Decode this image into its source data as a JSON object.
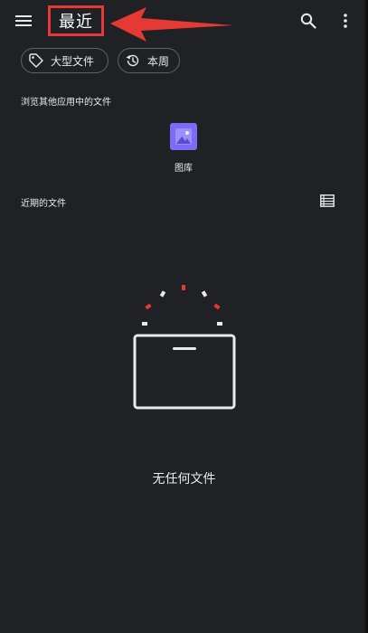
{
  "app_bar": {
    "title": "最近",
    "menu_icon": "hamburger-menu-icon",
    "search_icon": "search-icon",
    "more_icon": "more-vert-icon"
  },
  "annotation": {
    "highlight_color": "#e53935",
    "arrow_icon": "left-arrow-annotation"
  },
  "filters": [
    {
      "label": "大型文件",
      "icon": "tag-icon"
    },
    {
      "label": "本周",
      "icon": "history-icon"
    }
  ],
  "browse_section": {
    "label": "浏览其他应用中的文件",
    "apps": [
      {
        "label": "图库",
        "icon": "gallery-image-icon",
        "color": "#7c6cf5"
      }
    ]
  },
  "recent_section": {
    "label": "近期的文件",
    "view_toggle_icon": "list-view-icon"
  },
  "empty_state": {
    "text": "无任何文件",
    "icon": "empty-box-icon",
    "accent_color": "#e53935"
  }
}
